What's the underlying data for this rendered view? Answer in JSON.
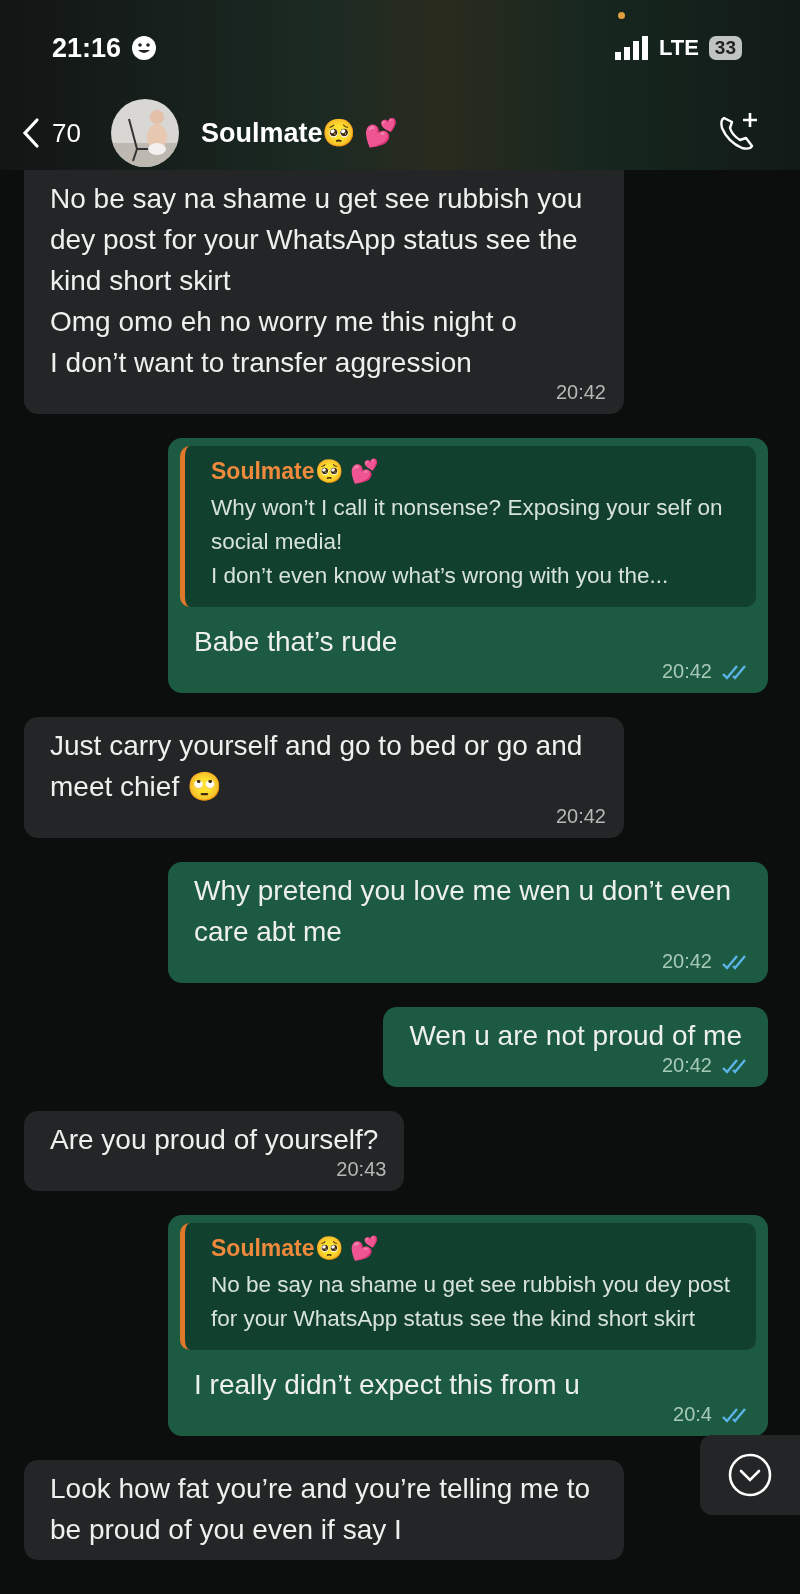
{
  "status_bar": {
    "time": "21:16",
    "network": "LTE",
    "battery": "33"
  },
  "header": {
    "back_count": "70",
    "contact_name": "Soulmate🥺 💕"
  },
  "messages": [
    {
      "kind": "incoming",
      "text": "No be say na shame u get see rubbish you dey post for your WhatsApp status see the kind short skirt\nOmg omo eh no worry me this night o\nI don’t want to transfer aggression",
      "time": "20:42"
    },
    {
      "kind": "outgoing",
      "quote": {
        "author": "Soulmate🥺 💕",
        "text": "Why won’t I call it nonsense? Exposing your self on social media!\nI don’t even know what’s wrong with you the..."
      },
      "text": "Babe that’s rude",
      "time": "20:42",
      "read": true
    },
    {
      "kind": "incoming",
      "text": "Just carry yourself and go to bed or go and meet chief 🙄",
      "time": "20:42"
    },
    {
      "kind": "outgoing",
      "text": "Why pretend you love me wen u don’t even care abt me",
      "time": "20:42",
      "read": true
    },
    {
      "kind": "outgoing",
      "text": "Wen u are not proud of me",
      "time": "20:42",
      "read": true
    },
    {
      "kind": "incoming",
      "text": "Are you proud of yourself?",
      "time": "20:43"
    },
    {
      "kind": "outgoing",
      "quote": {
        "author": "Soulmate🥺 💕",
        "text": "No be say na shame u get see rubbish you dey post for your WhatsApp status see the kind short skirt"
      },
      "text": "I really didn’t expect this from u",
      "time": "20:4",
      "read": true
    },
    {
      "kind": "incoming",
      "text": "Look how fat you’re and you’re telling me to be proud of you even if say I"
    }
  ]
}
